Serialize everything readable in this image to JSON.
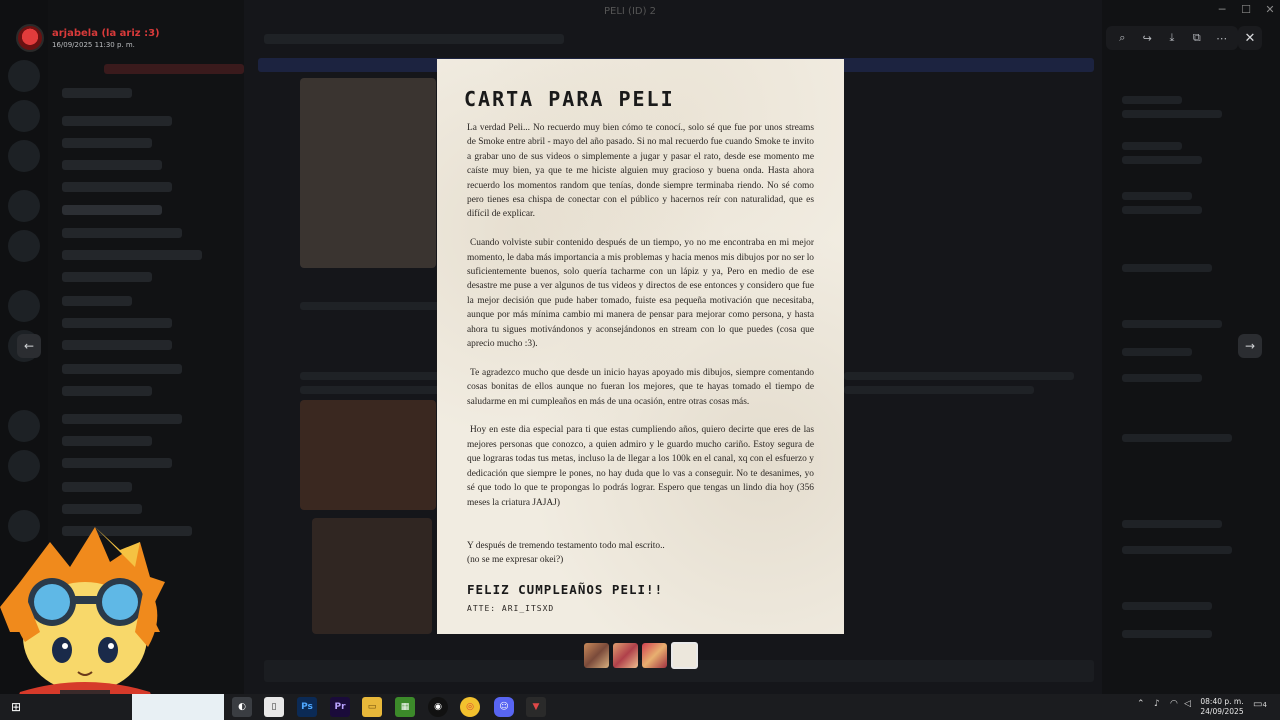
{
  "window": {
    "title": "PELI (ID) 2"
  },
  "uploader": {
    "name": "arjabela (la ariz :3)",
    "date": "16/09/2025 11:30 p. m."
  },
  "toolbar": {
    "buttons": [
      "zoom-in-icon",
      "forward-icon",
      "download-icon",
      "open-external-icon",
      "more-icon"
    ],
    "zoom": "⌕",
    "forward": "↪",
    "download": "⤓",
    "open": "⧉",
    "more": "⋯",
    "close": "✕"
  },
  "nav": {
    "prev": "←",
    "next": "→"
  },
  "letter": {
    "title": "CARTA PARA PELI",
    "paragraphs": [
      "La verdad Peli... No recuerdo muy bien cómo te conocí., solo sé que fue por unos streams de Smoke entre abril - mayo del año pasado. Si no mal recuerdo fue cuando Smoke te invito a grabar uno de sus videos o simplemente a jugar y pasar el rato, desde ese momento me caíste muy bien, ya que te me hiciste alguien muy gracioso y buena onda. Hasta ahora recuerdo los momentos random que tenías, donde siempre terminaba riendo. No sé como pero tienes esa chispa de conectar con el público y hacernos reír con naturalidad, que es difícil de explicar.",
      "Cuando volviste subir contenido después de un tiempo, yo no me encontraba en mi mejor momento, le daba más importancia a mis problemas y hacia menos mis dibujos por no ser lo suficientemente buenos, solo quería tacharme con un lápiz y ya, Pero en medio de ese desastre me puse a ver algunos de tus videos y directos de ese entonces y considero que fue la mejor decisión que pude haber tomado, fuiste esa pequeña motivación que necesitaba, aunque por más mínima cambio mi manera de pensar para mejorar como persona, y hasta ahora tu sigues motivándonos y aconsejándonos en stream con lo que puedes (cosa que aprecio mucho :3).",
      "Te agradezco mucho que desde un inicio hayas apoyado mis dibujos, siempre comentando cosas bonitas de ellos aunque no fueran los mejores, que te hayas tomado el tiempo de saludarme en mi cumpleaños en más de una ocasión, entre otras cosas más.",
      "Hoy en este dia especial para ti que estas cumpliendo años, quiero decirte que eres de las mejores personas que conozco, a quien admiro y le guardo mucho cariño. Estoy segura de que lograras todas tus metas, incluso la de llegar a los 100k en el canal, xq con el esfuerzo y dedicación que siempre le pones, no hay duda que lo vas a conseguir. No te desanimes, yo sé que todo lo que te propongas lo podrás lograr. Espero que tengas un lindo dia hoy (356 meses la criatura JAJAJ)"
    ],
    "closing_1": "Y después de tremendo testamento todo mal escrito..",
    "closing_2": "(no se me expresar okei?)",
    "wish": "FELIZ CUMPLEAÑOS PELI!!",
    "signature": "ATTE: ARI_ITSXD"
  },
  "thumbnails": [
    "thumb-1",
    "thumb-2",
    "thumb-3",
    "thumb-4"
  ],
  "taskbar": {
    "time": "08:40 p. m.",
    "date": "24/09/2025",
    "notif_count": "4"
  }
}
